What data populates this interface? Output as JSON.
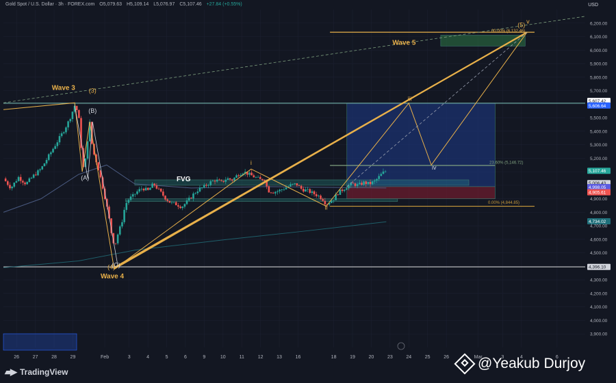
{
  "header": {
    "symbol": "Gold Spot / U.S. Dollar · 3h · FOREX.com",
    "open": "O5,079.63",
    "high": "H5,109.14",
    "low": "L5,076.97",
    "close": "C5,107.46",
    "change": "+27.84 (+0.55%)"
  },
  "currency": "USD",
  "branding": {
    "logo_text": "TradingView"
  },
  "watermark": {
    "text": "@Yeakub Durjoy"
  },
  "colors": {
    "bg": "#131722",
    "bull": "#26a69a",
    "bear": "#ef5350",
    "wave": "#e8b04a",
    "text": "#d1d4dc",
    "blue_zone": "#1e3a8a",
    "green_zone": "#1e4d3a"
  },
  "chart_data": {
    "type": "candlestick",
    "symbol": "XAUUSD",
    "timeframe": "3h",
    "ylim": [
      3800,
      6300
    ],
    "y_ticks": [
      3900,
      4000,
      4100,
      4200,
      4300,
      4400,
      4500,
      4600,
      4700,
      4800,
      4900,
      5000,
      5100,
      5200,
      5300,
      5400,
      5500,
      5600,
      5700,
      5800,
      5900,
      6000,
      6100,
      6200
    ],
    "x_ticks": [
      {
        "label": "26",
        "x": 0.7
      },
      {
        "label": "27",
        "x": 1.7
      },
      {
        "label": "28",
        "x": 2.7
      },
      {
        "label": "29",
        "x": 3.7
      },
      {
        "label": "Feb",
        "x": 5.4
      },
      {
        "label": "3",
        "x": 6.7
      },
      {
        "label": "4",
        "x": 7.7
      },
      {
        "label": "5",
        "x": 8.7
      },
      {
        "label": "6",
        "x": 9.7
      },
      {
        "label": "9",
        "x": 10.7
      },
      {
        "label": "10",
        "x": 11.7
      },
      {
        "label": "11",
        "x": 12.7
      },
      {
        "label": "12",
        "x": 13.7
      },
      {
        "label": "13",
        "x": 14.7
      },
      {
        "label": "16",
        "x": 15.7
      },
      {
        "label": "18",
        "x": 17.6
      },
      {
        "label": "19",
        "x": 18.6
      },
      {
        "label": "20",
        "x": 19.6
      },
      {
        "label": "23",
        "x": 20.6
      },
      {
        "label": "24",
        "x": 21.6
      },
      {
        "label": "25",
        "x": 22.6
      },
      {
        "label": "26",
        "x": 23.6
      },
      {
        "label": "Mar",
        "x": 25.3
      },
      {
        "label": "3",
        "x": 26.6
      },
      {
        "label": "4",
        "x": 27.6
      },
      {
        "label": "6",
        "x": 29.5
      }
    ],
    "x_domain": [
      0,
      31
    ],
    "price_path": [
      [
        0,
        5050
      ],
      [
        0.4,
        4980
      ],
      [
        0.8,
        5060
      ],
      [
        1.2,
        5010
      ],
      [
        1.6,
        5070
      ],
      [
        2.0,
        5120
      ],
      [
        2.3,
        5190
      ],
      [
        2.6,
        5260
      ],
      [
        2.9,
        5330
      ],
      [
        3.2,
        5400
      ],
      [
        3.5,
        5480
      ],
      [
        3.8,
        5590
      ],
      [
        4.0,
        5530
      ],
      [
        4.2,
        5180
      ],
      [
        4.3,
        5090
      ],
      [
        4.45,
        5300
      ],
      [
        4.6,
        5460
      ],
      [
        4.75,
        5260
      ],
      [
        4.9,
        5200
      ],
      [
        5.1,
        5100
      ],
      [
        5.3,
        4980
      ],
      [
        5.5,
        4850
      ],
      [
        5.7,
        4700
      ],
      [
        5.8,
        4600
      ],
      [
        5.95,
        4560
      ],
      [
        6.1,
        4640
      ],
      [
        6.3,
        4720
      ],
      [
        6.5,
        4860
      ],
      [
        6.7,
        4900
      ],
      [
        6.9,
        4920
      ],
      [
        7.1,
        4950
      ],
      [
        7.4,
        4980
      ],
      [
        7.7,
        4960
      ],
      [
        8.0,
        5010
      ],
      [
        8.3,
        4960
      ],
      [
        8.6,
        4910
      ],
      [
        8.9,
        4870
      ],
      [
        9.2,
        4860
      ],
      [
        9.5,
        4840
      ],
      [
        9.8,
        4880
      ],
      [
        10.1,
        4930
      ],
      [
        10.4,
        4970
      ],
      [
        10.7,
        4990
      ],
      [
        11.0,
        5020
      ],
      [
        11.3,
        5040
      ],
      [
        11.6,
        5020
      ],
      [
        11.9,
        5050
      ],
      [
        12.2,
        5040
      ],
      [
        12.5,
        5080
      ],
      [
        12.8,
        5100
      ],
      [
        13.1,
        5080
      ],
      [
        13.4,
        5060
      ],
      [
        13.7,
        5040
      ],
      [
        13.9,
        5050
      ],
      [
        14.1,
        4960
      ],
      [
        14.4,
        4950
      ],
      [
        14.7,
        4960
      ],
      [
        15.0,
        4980
      ],
      [
        15.3,
        5000
      ],
      [
        15.6,
        5010
      ],
      [
        15.9,
        4970
      ],
      [
        16.2,
        4960
      ],
      [
        16.5,
        4940
      ],
      [
        16.8,
        4920
      ],
      [
        17.0,
        4900
      ],
      [
        17.2,
        4860
      ],
      [
        17.4,
        4880
      ],
      [
        17.6,
        4900
      ],
      [
        17.8,
        4940
      ],
      [
        18.0,
        4960
      ],
      [
        18.3,
        4990
      ],
      [
        18.6,
        5010
      ],
      [
        18.9,
        5000
      ],
      [
        19.2,
        5020
      ],
      [
        19.5,
        5010
      ],
      [
        19.8,
        5030
      ],
      [
        20.0,
        5060
      ],
      [
        20.2,
        5090
      ],
      [
        20.4,
        5107
      ]
    ],
    "candle_colors": "derived from price_path direction",
    "moving_averages": [
      {
        "color": "#4a5a80",
        "points": [
          [
            0,
            4800
          ],
          [
            2,
            4900
          ],
          [
            4,
            5080
          ],
          [
            5.5,
            5150
          ],
          [
            7,
            5010
          ],
          [
            10,
            4980
          ],
          [
            14,
            4990
          ],
          [
            20.4,
            4980
          ]
        ]
      },
      {
        "color": "#1f5f6a",
        "points": [
          [
            0,
            4390
          ],
          [
            4,
            4440
          ],
          [
            7,
            4520
          ],
          [
            12,
            4600
          ],
          [
            16,
            4660
          ],
          [
            20.4,
            4730
          ]
        ]
      }
    ],
    "horizontal_levels": [
      {
        "value": 5607.42,
        "color": "#6aa6a0"
      },
      {
        "value": 4396.1,
        "color": "#c8c8c8"
      },
      {
        "value": 5146.72,
        "color": "#7fa07f"
      },
      {
        "value": 4844.85,
        "color": "#c89a3a"
      },
      {
        "value": 6132.46,
        "color": "#e8b04a"
      }
    ],
    "zones": [
      {
        "name": "target-box-blue",
        "x0": 18.3,
        "x1": 26.2,
        "y0": 4990,
        "y1": 5607,
        "color": "rgba(30,58,138,0.55)"
      },
      {
        "name": "fvg-box",
        "x0": 7.0,
        "x1": 24.8,
        "y0": 5000,
        "y1": 5040,
        "color": "rgba(38,166,154,0.25)",
        "label": "FVG"
      },
      {
        "name": "support-box",
        "x0": 6.5,
        "x1": 21.0,
        "y0": 4880,
        "y1": 4900,
        "color": "rgba(38,166,154,0.25)"
      },
      {
        "name": "red-box",
        "x0": 18.3,
        "x1": 26.2,
        "y0": 4900,
        "y1": 4990,
        "color": "rgba(139,30,50,0.55)"
      },
      {
        "name": "target-green",
        "x0": 23.3,
        "x1": 27.8,
        "y0": 6030,
        "y1": 6110,
        "color": "rgba(46,120,70,0.55)"
      }
    ],
    "wave_labels": [
      {
        "text": "Wave 3",
        "x": 3.2,
        "y": 5705,
        "color": "#e8b04a",
        "bold": true
      },
      {
        "text": "(3)",
        "x": 4.75,
        "y": 5685,
        "color": "#e8b04a"
      },
      {
        "text": "(B)",
        "x": 4.75,
        "y": 5535,
        "color": "#d1d4dc"
      },
      {
        "text": "(A)",
        "x": 4.35,
        "y": 5040,
        "color": "#d1d4dc"
      },
      {
        "text": "(4)",
        "x": 5.75,
        "y": 4380,
        "color": "#e8b04a"
      },
      {
        "text": "(C)",
        "x": 6.0,
        "y": 4395,
        "color": "#d1d4dc"
      },
      {
        "text": "Wave 4",
        "x": 5.8,
        "y": 4310,
        "color": "#e8b04a",
        "bold": true
      },
      {
        "text": "i",
        "x": 13.2,
        "y": 5152,
        "color": "#e8b04a"
      },
      {
        "text": "ii",
        "x": 17.2,
        "y": 4820,
        "color": "#e8b04a"
      },
      {
        "text": "iii",
        "x": 21.65,
        "y": 5625,
        "color": "#e8b04a"
      },
      {
        "text": "iv",
        "x": 22.95,
        "y": 5115,
        "color": "#d1d4dc"
      },
      {
        "text": "(5)",
        "x": 27.6,
        "y": 6170,
        "color": "#e8b04a"
      },
      {
        "text": "v",
        "x": 27.95,
        "y": 6195,
        "color": "#e8b04a"
      },
      {
        "text": "Wave 5",
        "x": 21.35,
        "y": 6040,
        "color": "#e8b04a",
        "bold": true
      },
      {
        "text": "FVG",
        "x": 9.6,
        "y": 5030,
        "color": "#ffffff",
        "bold": true
      }
    ],
    "fib_labels": [
      {
        "text": "00.00% (6,132.46)",
        "x": 27.8,
        "y": 6132,
        "color": "#e8b04a"
      },
      {
        "text": "23.60% (5,146.72)",
        "x": 27.7,
        "y": 5160,
        "color": "#7fa07f"
      },
      {
        "text": "0.00% (4,844.85)",
        "x": 27.5,
        "y": 4862,
        "color": "#c89a3a"
      }
    ],
    "price_tags": [
      {
        "text": "5,607.42",
        "value": 5624,
        "bg": "#ffffff",
        "fg": "#131722"
      },
      {
        "text": "5,606.64",
        "value": 5590,
        "bg": "#2962ff",
        "fg": "#ffffff"
      },
      {
        "text": "5,107.46",
        "value": 5107,
        "bg": "#26a69a",
        "fg": "#ffffff"
      },
      {
        "text": "5,006.43",
        "value": 5016,
        "bg": "#d1d4dc",
        "fg": "#131722"
      },
      {
        "text": "4,998.05",
        "value": 4987,
        "bg": "#5c5ce0",
        "fg": "#ffffff"
      },
      {
        "text": "4,905.61",
        "value": 4948,
        "bg": "#ef5350",
        "fg": "#ffffff"
      },
      {
        "text": "4,734.02",
        "value": 4734,
        "bg": "#1f6f7a",
        "fg": "#ffffff"
      },
      {
        "text": "4,396.10",
        "value": 4396,
        "bg": "#d1d4dc",
        "fg": "#131722"
      }
    ],
    "wave_lines": [
      {
        "color": "#e8b04a",
        "width": 1,
        "points": [
          [
            0,
            5560
          ],
          [
            3.8,
            5610
          ],
          [
            4.2,
            5100
          ],
          [
            4.6,
            5470
          ],
          [
            5.9,
            4380
          ],
          [
            13.2,
            5120
          ],
          [
            17.2,
            4845
          ],
          [
            21.6,
            5607
          ],
          [
            22.8,
            5150
          ],
          [
            27.9,
            6132
          ]
        ]
      },
      {
        "color": "#e8b04a",
        "width": 2.2,
        "points": [
          [
            5.9,
            4390
          ],
          [
            27.9,
            6132
          ]
        ]
      },
      {
        "color": "#e8b04a",
        "width": 1.5,
        "points": [
          [
            5.9,
            4380
          ],
          [
            27.8,
            6125
          ]
        ]
      },
      {
        "color": "#d1d4dc",
        "width": 0.8,
        "points": [
          [
            3.8,
            5590
          ],
          [
            4.5,
            5050
          ],
          [
            4.75,
            5470
          ],
          [
            6.1,
            4400
          ]
        ]
      },
      {
        "color": "#7fa07f",
        "width": 0.8,
        "dashed": true,
        "points": [
          [
            0,
            5610
          ],
          [
            31,
            6250
          ]
        ]
      },
      {
        "color": "#9aa0b0",
        "width": 0.8,
        "dashed": true,
        "points": [
          [
            18.3,
            4990
          ],
          [
            27.9,
            6132
          ]
        ]
      }
    ]
  }
}
